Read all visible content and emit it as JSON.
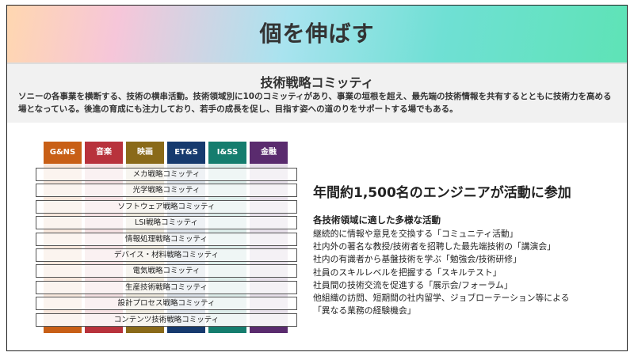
{
  "page": {
    "title": "個を伸ばす"
  },
  "section": {
    "title": "技術戦略コミッティ",
    "description": "ソニーの各事業を横断する、技術の横串活動。技術領域別に10のコミッティがあり、事業の垣根を超え、最先端の技術情報を共有するとともに技術力を高める場となっている。後進の育成にも注力しており、若手の成長を促し、目指す姿への道のりをサポートする場でもある。"
  },
  "diagram": {
    "columns": [
      {
        "label": "G&NS",
        "color": "#c85f16"
      },
      {
        "label": "音楽",
        "color": "#b8323c"
      },
      {
        "label": "映画",
        "color": "#8a6a19"
      },
      {
        "label": "ET&S",
        "color": "#163a6e"
      },
      {
        "label": "I&SS",
        "color": "#157d6e"
      },
      {
        "label": "金融",
        "color": "#5a2b6e"
      }
    ],
    "rows": [
      "メカ戦略コミッティ",
      "光学戦略コミッティ",
      "ソフトウェア戦略コミッティ",
      "LSI戦略コミッティ",
      "情報処理戦略コミッティ",
      "デバイス・材料戦略コミッティ",
      "電気戦略コミッティ",
      "生産技術戦略コミッティ",
      "設計プロセス戦略コミッティ",
      "コンテンツ技術戦略コミッティ"
    ]
  },
  "info": {
    "headline": "年間約1,500名のエンジニアが活動に参加",
    "activities_title": "各技術領域に適した多様な活動",
    "activities": [
      "継続的に情報や意見を交換する「コミュニティ活動」",
      "社内外の著名な教授/技術者を招聘した最先端技術の「講演会」",
      "社内の有識者から基盤技術を学ぶ「勉強会/技術研修」",
      "社員のスキルレベルを把握する「スキルテスト」",
      "社員間の技術交流を促進する「展示会/フォーラム」",
      "他組織の訪問、短期間の社内留学、ジョブローテーション等による",
      "「異なる業務の経験機会」"
    ]
  }
}
